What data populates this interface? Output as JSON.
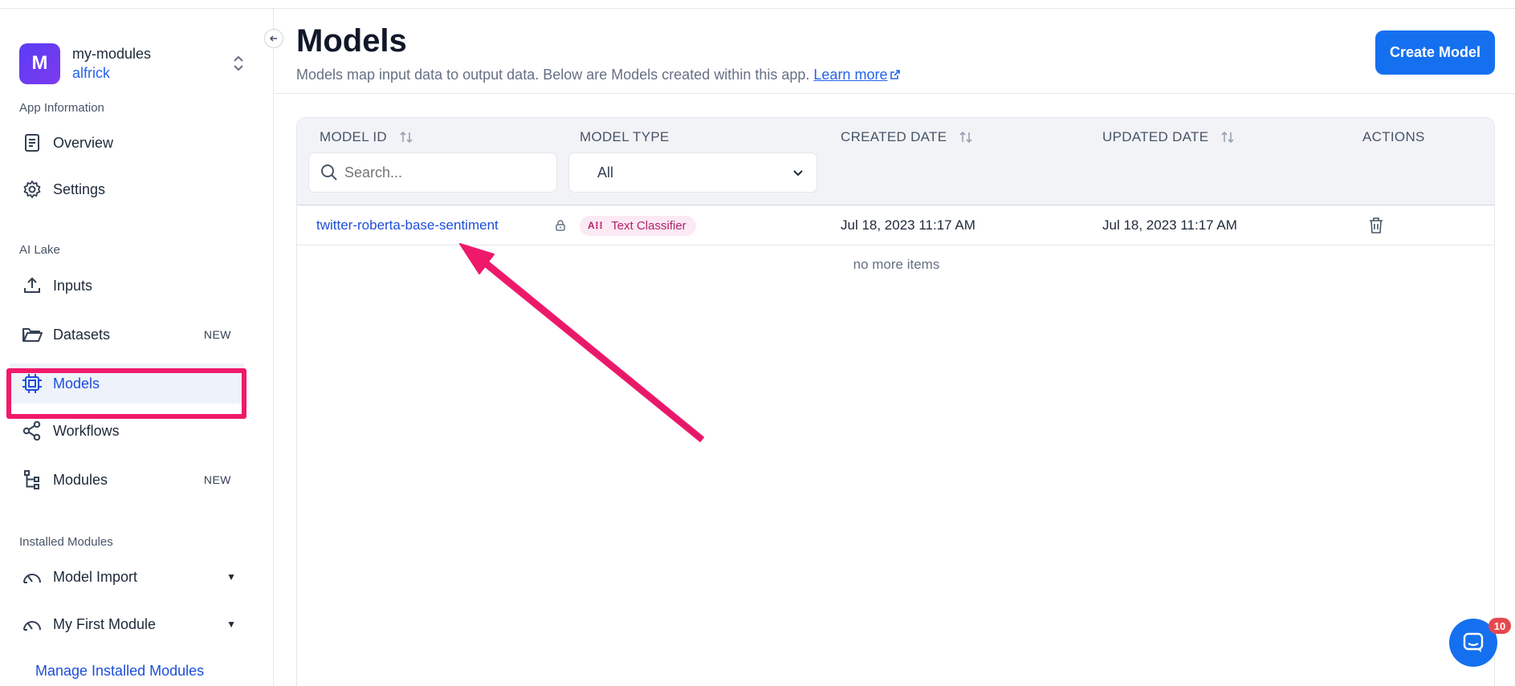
{
  "app": {
    "avatar_letter": "M",
    "name": "my-modules",
    "user": "alfrick"
  },
  "sidebar": {
    "section_app_info": "App Information",
    "section_ai_lake": "AI Lake",
    "section_installed": "Installed Modules",
    "items": {
      "overview": {
        "label": "Overview",
        "icon": "document-icon"
      },
      "settings": {
        "label": "Settings",
        "icon": "gear-icon"
      },
      "inputs": {
        "label": "Inputs",
        "icon": "upload-icon"
      },
      "datasets": {
        "label": "Datasets",
        "icon": "folder-icon",
        "badge": "NEW"
      },
      "models": {
        "label": "Models",
        "icon": "chip-icon",
        "active": true
      },
      "workflows": {
        "label": "Workflows",
        "icon": "share-icon"
      },
      "modules": {
        "label": "Modules",
        "icon": "tree-icon",
        "badge": "NEW"
      },
      "model_import": {
        "label": "Model Import",
        "icon": "gauge-icon"
      },
      "my_first_module": {
        "label": "My First Module",
        "icon": "gauge-icon"
      }
    },
    "manage_link": "Manage Installed Modules"
  },
  "page": {
    "title": "Models",
    "description": "Models map input data to output data. Below are Models created within this app.",
    "learn_more": "Learn more",
    "create_button": "Create Model"
  },
  "table": {
    "columns": {
      "model_id": "MODEL ID",
      "model_type": "MODEL TYPE",
      "created_date": "CREATED DATE",
      "updated_date": "UPDATED DATE",
      "actions": "ACTIONS"
    },
    "search_placeholder": "Search...",
    "type_filter_value": "All",
    "rows": [
      {
        "model_id": "twitter-roberta-base-sentiment",
        "type_abbr": "A⁝⁝",
        "type": "Text Classifier",
        "created": "Jul 18, 2023 11:17 AM",
        "updated": "Jul 18, 2023 11:17 AM"
      }
    ],
    "footer": "no more items"
  },
  "chat": {
    "unread_count": "10"
  },
  "colors": {
    "accent": "#1570ef",
    "annotation": "#f0196a",
    "pill_bg": "#fbe9f3",
    "pill_text": "#b3206b"
  }
}
